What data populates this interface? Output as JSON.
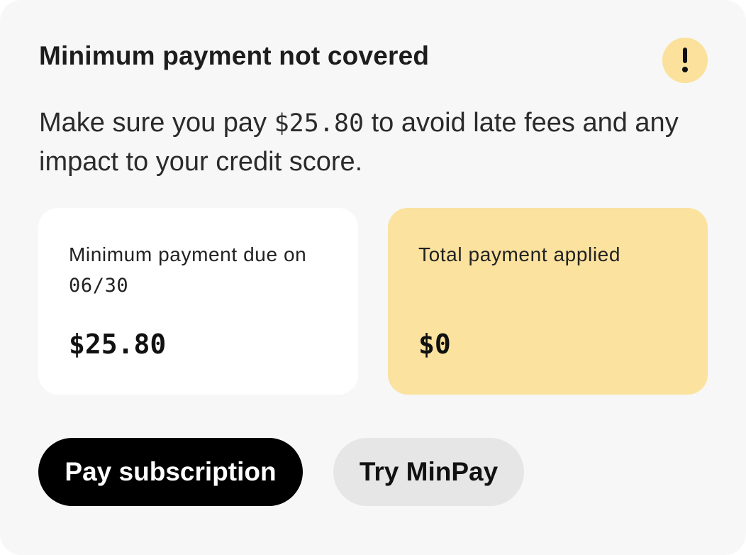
{
  "card": {
    "title": "Minimum payment not covered",
    "alert_icon": "exclamation-icon",
    "message_before": "Make sure you pay ",
    "message_amount": "$25.80",
    "message_after": " to avoid late fees and any impact to your credit score."
  },
  "minimum_tile": {
    "label_prefix": "Minimum payment due on ",
    "label_date": "06/30",
    "amount": "$25.80"
  },
  "total_tile": {
    "label": "Total payment applied",
    "amount": "$0"
  },
  "actions": {
    "primary_label": "Pay subscription",
    "secondary_label": "Try MinPay"
  },
  "colors": {
    "card_background": "#f7f7f7",
    "alert_badge": "#fbe19b",
    "total_tile": "#fbe29f",
    "primary_button": "#000000",
    "secondary_button": "#e6e6e6"
  }
}
